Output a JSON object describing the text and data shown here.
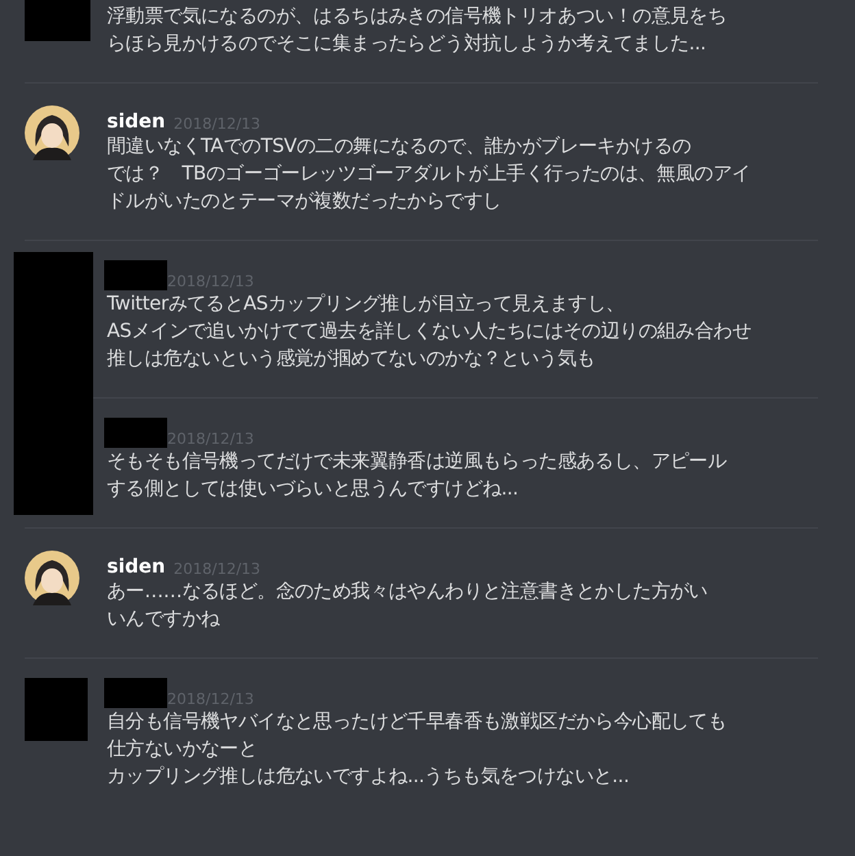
{
  "messages": [
    {
      "avatar_redacted": true,
      "lines": [
        "浮動票で気になるのが、はるちはみきの信号機トリオあつい！の意見をち",
        "らほら見かけるのでそこに集まったらどう対抗しようか考えてました..."
      ]
    },
    {
      "avatar_redacted": false,
      "author": "siden",
      "name_redacted": false,
      "date": "2018/12/13",
      "lines": [
        "間違いなくTAでのTSVの二の舞になるので、誰かがブレーキかけるの",
        "では？　TBのゴーゴーレッツゴーアダルトが上手く行ったのは、無風のアイ",
        "ドルがいたのとテーマが複数だったからですし"
      ]
    },
    {
      "avatar_redacted": true,
      "name_redacted": true,
      "date": "2018/12/13",
      "lines": [
        "TwitterみてるとASカップリング推しが目立って見えますし、",
        "ASメインで追いかけてて過去を詳しくない人たちにはその辺りの組み合わせ",
        "推しは危ないという感覚が掴めてないのかな？という気も"
      ]
    },
    {
      "avatar_redacted": true,
      "name_redacted": true,
      "date": "2018/12/13",
      "lines": [
        "そもそも信号機ってだけで未来翼静香は逆風もらった感あるし、アピール",
        "する側としては使いづらいと思うんですけどね..."
      ]
    },
    {
      "avatar_redacted": false,
      "author": "siden",
      "name_redacted": false,
      "date": "2018/12/13",
      "lines": [
        "あー……なるほど。念のため我々はやんわりと注意書きとかした方がい",
        "いんですかね"
      ]
    },
    {
      "avatar_redacted": true,
      "name_redacted": true,
      "date": "2018/12/13",
      "lines": [
        "自分も信号機ヤバイなと思ったけど千早春香も激戦区だから今心配しても",
        "仕方ないかなーと",
        "カップリング推しは危ないですよね...うちも気をつけないと..."
      ]
    }
  ]
}
